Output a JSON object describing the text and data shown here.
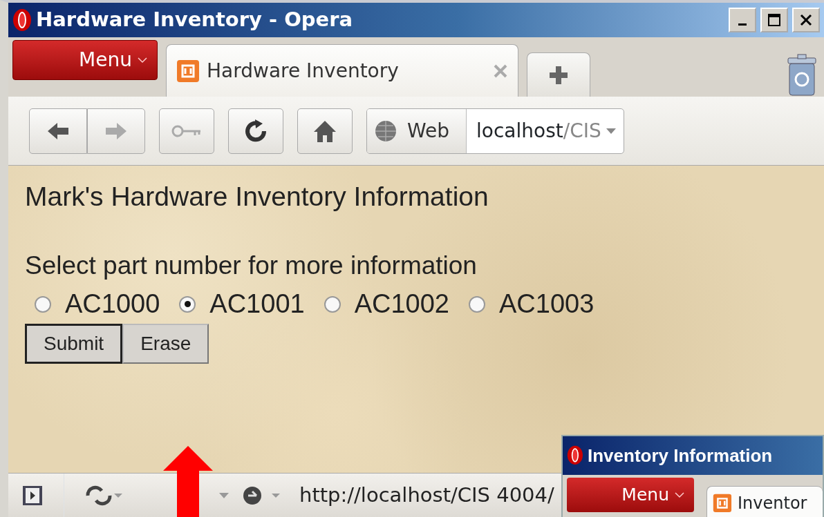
{
  "window": {
    "title": "Hardware Inventory - Opera"
  },
  "menu_button": {
    "label": "Menu"
  },
  "tabs": [
    {
      "label": "Hardware Inventory",
      "selected": true
    }
  ],
  "address_bar": {
    "search_engine": "Web",
    "url_host": "localhost",
    "url_path": "/CIS"
  },
  "page": {
    "heading": "Mark's Hardware Inventory Information",
    "prompt": "Select part number for more information",
    "options": [
      {
        "label": "AC1000",
        "selected": false
      },
      {
        "label": "AC1001",
        "selected": true
      },
      {
        "label": "AC1002",
        "selected": false
      },
      {
        "label": "AC1003",
        "selected": false
      }
    ],
    "buttons": [
      {
        "label": "Submit",
        "focused": true
      },
      {
        "label": "Erase",
        "focused": false
      }
    ]
  },
  "status_bar": {
    "url": "http://localhost/CIS 4004/"
  },
  "second_window": {
    "title": "Inventory Information",
    "menu_label": "Menu",
    "tab_label": "Inventor"
  }
}
